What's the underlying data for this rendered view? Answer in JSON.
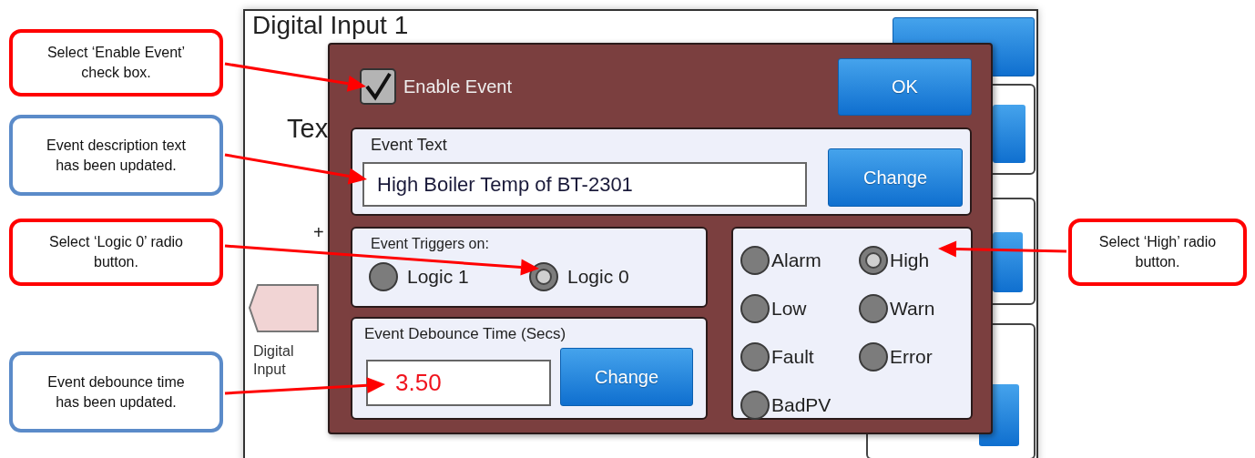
{
  "callouts": [
    {
      "text": "Select ‘Enable Event’ check box.",
      "color": "#ff0000"
    },
    {
      "text": "Event description text has been updated.",
      "color": "#5b8bc9"
    },
    {
      "text": "Select ‘Logic 0’ radio button.",
      "color": "#ff0000"
    },
    {
      "text": "Event debounce time has been updated.",
      "color": "#5b8bc9"
    },
    {
      "text": "Select ‘High’ radio button.",
      "color": "#ff0000"
    }
  ],
  "screen": {
    "title": "Digital Input 1",
    "label_cut": "Tex",
    "plus_sign": "+",
    "node_label": "Digital Input"
  },
  "dialog": {
    "enable_event": {
      "label": "Enable Event",
      "checked": true
    },
    "ok_button": "OK",
    "event_text": {
      "heading": "Event Text",
      "value": "High Boiler Temp of BT-2301",
      "button": "Change"
    },
    "triggers": {
      "heading": "Event Triggers on:",
      "options": [
        {
          "label": "Logic 1",
          "selected": false
        },
        {
          "label": "Logic 0",
          "selected": true
        }
      ]
    },
    "debounce": {
      "heading": "Event Debounce Time (Secs)",
      "value": "3.50",
      "button": "Change"
    },
    "levels": [
      {
        "label": "Alarm",
        "selected": false
      },
      {
        "label": "High",
        "selected": true
      },
      {
        "label": "Low",
        "selected": false
      },
      {
        "label": "Warn",
        "selected": false
      },
      {
        "label": "Fault",
        "selected": false
      },
      {
        "label": "Error",
        "selected": false
      },
      {
        "label": "BadPV",
        "selected": false
      }
    ]
  }
}
